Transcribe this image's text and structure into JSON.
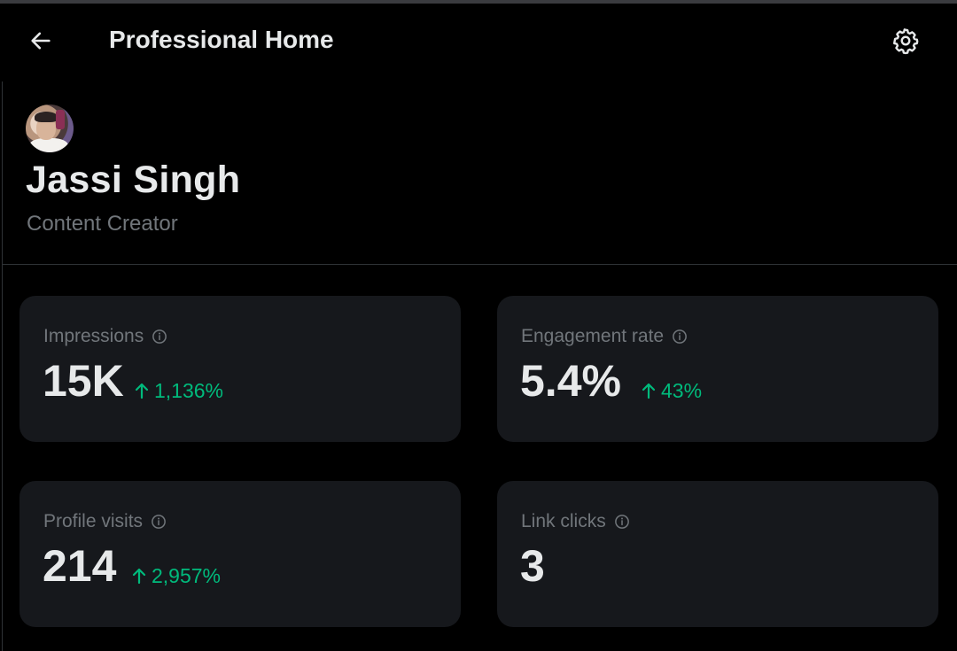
{
  "header": {
    "title": "Professional Home",
    "back_icon": "arrow-left-icon",
    "settings_icon": "gear-icon"
  },
  "profile": {
    "name": "Jassi Singh",
    "role": "Content Creator"
  },
  "metrics": [
    {
      "label": "Impressions",
      "value": "15K",
      "delta": "1,136%",
      "trend": "up"
    },
    {
      "label": "Engagement rate",
      "value": "5.4%",
      "delta": "43%",
      "trend": "up"
    },
    {
      "label": "Profile visits",
      "value": "214",
      "delta": "2,957%",
      "trend": "up"
    },
    {
      "label": "Link clicks",
      "value": "3",
      "delta": "",
      "trend": ""
    }
  ],
  "colors": {
    "background": "#000000",
    "card": "#16181c",
    "text_primary": "#e7e9ea",
    "text_secondary": "#71767b",
    "positive": "#00ba7c"
  }
}
